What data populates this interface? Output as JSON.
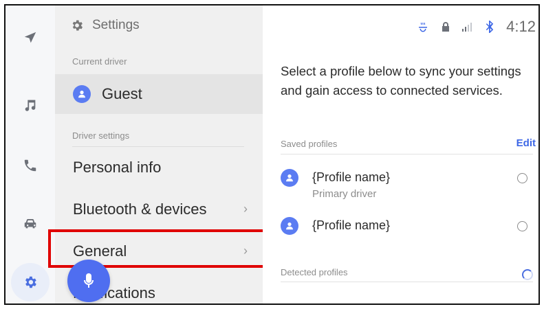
{
  "menu": {
    "title": "Settings",
    "current_driver_label": "Current driver",
    "current_driver_name": "Guest",
    "driver_settings_label": "Driver settings",
    "items": [
      {
        "label": "Personal info"
      },
      {
        "label": "Bluetooth & devices",
        "chevron": "›"
      },
      {
        "label": "General",
        "chevron": "›"
      },
      {
        "label": "Notifications"
      }
    ]
  },
  "status": {
    "time": "4:12",
    "icons": [
      "steering-wheel-heat-icon",
      "lock-icon",
      "signal-icon",
      "bluetooth-icon"
    ]
  },
  "content": {
    "intro": "Select a profile below to sync your settings and gain access to connected services.",
    "saved_label": "Saved profiles",
    "edit_label": "Edit",
    "profiles": [
      {
        "name": "{Profile name}",
        "subtitle": "Primary driver"
      },
      {
        "name": "{Profile name}",
        "subtitle": ""
      }
    ],
    "detected_label": "Detected profiles"
  },
  "rail": {
    "icons": [
      "navigation-icon",
      "music-icon",
      "phone-icon",
      "car-icon",
      "settings-gear-icon"
    ],
    "active": "settings-gear-icon"
  },
  "colors": {
    "accent": "#4a6ee0",
    "avatar": "#5b7cf2",
    "highlight": "#e00000"
  }
}
